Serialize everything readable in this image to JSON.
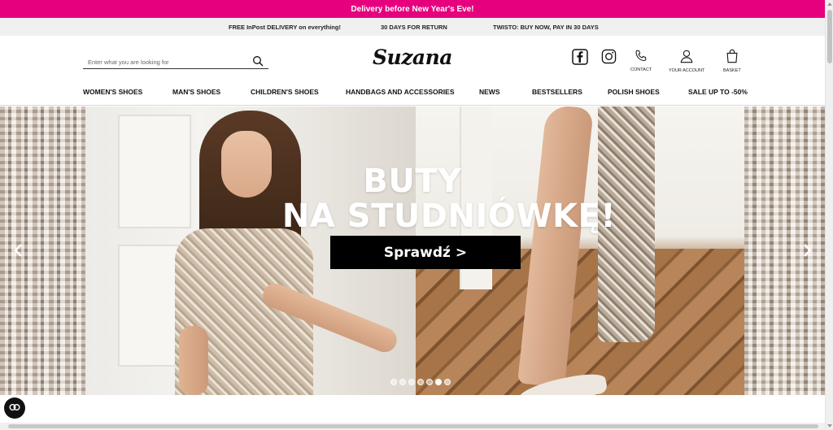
{
  "promo": {
    "text": "Delivery before New Year's Eve!"
  },
  "info_bar": {
    "items": [
      "FREE InPost DELIVERY on everything!",
      "30 DAYS FOR RETURN",
      "TWISTO: BUY NOW, PAY IN 30 DAYS"
    ]
  },
  "header": {
    "search": {
      "placeholder": "Enter what you are looking for"
    },
    "logo": "Suzana",
    "contact_label": "CONTACT",
    "account_label": "YOUR ACCOUNT",
    "basket_label": "BASKET",
    "icons": [
      "facebook-icon",
      "instagram-icon",
      "phone-icon",
      "user-icon",
      "bag-icon",
      "search-icon"
    ]
  },
  "nav": {
    "items": [
      "WOMEN'S SHOES",
      "MAN'S SHOES",
      "CHILDREN'S SHOES",
      "HANDBAGS AND ACCESSORIES",
      "NEWS",
      "BESTSELLERS",
      "POLISH SHOES",
      "SALE UP TO -50%"
    ]
  },
  "hero": {
    "title_line1": "BUTY",
    "title_line2": "NA STUDNIÓWKĘ!",
    "cta": "Sprawdź >",
    "slides_count": 7,
    "active_slide": 5
  },
  "colors": {
    "promo": "#e6007e",
    "info_bar": "#f0f0f0",
    "cta": "#000000"
  }
}
